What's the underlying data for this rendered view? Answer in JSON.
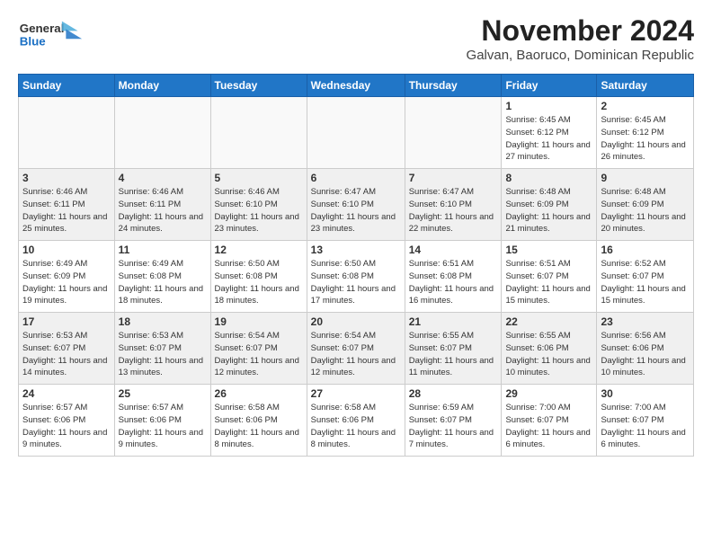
{
  "header": {
    "logo_line1": "General",
    "logo_line2": "Blue",
    "title": "November 2024",
    "subtitle": "Galvan, Baoruco, Dominican Republic"
  },
  "days_of_week": [
    "Sunday",
    "Monday",
    "Tuesday",
    "Wednesday",
    "Thursday",
    "Friday",
    "Saturday"
  ],
  "weeks": [
    [
      {
        "day": "",
        "info": "",
        "empty": true
      },
      {
        "day": "",
        "info": "",
        "empty": true
      },
      {
        "day": "",
        "info": "",
        "empty": true
      },
      {
        "day": "",
        "info": "",
        "empty": true
      },
      {
        "day": "",
        "info": "",
        "empty": true
      },
      {
        "day": "1",
        "info": "Sunrise: 6:45 AM\nSunset: 6:12 PM\nDaylight: 11 hours\nand 27 minutes."
      },
      {
        "day": "2",
        "info": "Sunrise: 6:45 AM\nSunset: 6:12 PM\nDaylight: 11 hours\nand 26 minutes."
      }
    ],
    [
      {
        "day": "3",
        "info": "Sunrise: 6:46 AM\nSunset: 6:11 PM\nDaylight: 11 hours\nand 25 minutes."
      },
      {
        "day": "4",
        "info": "Sunrise: 6:46 AM\nSunset: 6:11 PM\nDaylight: 11 hours\nand 24 minutes."
      },
      {
        "day": "5",
        "info": "Sunrise: 6:46 AM\nSunset: 6:10 PM\nDaylight: 11 hours\nand 23 minutes."
      },
      {
        "day": "6",
        "info": "Sunrise: 6:47 AM\nSunset: 6:10 PM\nDaylight: 11 hours\nand 23 minutes."
      },
      {
        "day": "7",
        "info": "Sunrise: 6:47 AM\nSunset: 6:10 PM\nDaylight: 11 hours\nand 22 minutes."
      },
      {
        "day": "8",
        "info": "Sunrise: 6:48 AM\nSunset: 6:09 PM\nDaylight: 11 hours\nand 21 minutes."
      },
      {
        "day": "9",
        "info": "Sunrise: 6:48 AM\nSunset: 6:09 PM\nDaylight: 11 hours\nand 20 minutes."
      }
    ],
    [
      {
        "day": "10",
        "info": "Sunrise: 6:49 AM\nSunset: 6:09 PM\nDaylight: 11 hours\nand 19 minutes."
      },
      {
        "day": "11",
        "info": "Sunrise: 6:49 AM\nSunset: 6:08 PM\nDaylight: 11 hours\nand 18 minutes."
      },
      {
        "day": "12",
        "info": "Sunrise: 6:50 AM\nSunset: 6:08 PM\nDaylight: 11 hours\nand 18 minutes."
      },
      {
        "day": "13",
        "info": "Sunrise: 6:50 AM\nSunset: 6:08 PM\nDaylight: 11 hours\nand 17 minutes."
      },
      {
        "day": "14",
        "info": "Sunrise: 6:51 AM\nSunset: 6:08 PM\nDaylight: 11 hours\nand 16 minutes."
      },
      {
        "day": "15",
        "info": "Sunrise: 6:51 AM\nSunset: 6:07 PM\nDaylight: 11 hours\nand 15 minutes."
      },
      {
        "day": "16",
        "info": "Sunrise: 6:52 AM\nSunset: 6:07 PM\nDaylight: 11 hours\nand 15 minutes."
      }
    ],
    [
      {
        "day": "17",
        "info": "Sunrise: 6:53 AM\nSunset: 6:07 PM\nDaylight: 11 hours\nand 14 minutes."
      },
      {
        "day": "18",
        "info": "Sunrise: 6:53 AM\nSunset: 6:07 PM\nDaylight: 11 hours\nand 13 minutes."
      },
      {
        "day": "19",
        "info": "Sunrise: 6:54 AM\nSunset: 6:07 PM\nDaylight: 11 hours\nand 12 minutes."
      },
      {
        "day": "20",
        "info": "Sunrise: 6:54 AM\nSunset: 6:07 PM\nDaylight: 11 hours\nand 12 minutes."
      },
      {
        "day": "21",
        "info": "Sunrise: 6:55 AM\nSunset: 6:07 PM\nDaylight: 11 hours\nand 11 minutes."
      },
      {
        "day": "22",
        "info": "Sunrise: 6:55 AM\nSunset: 6:06 PM\nDaylight: 11 hours\nand 10 minutes."
      },
      {
        "day": "23",
        "info": "Sunrise: 6:56 AM\nSunset: 6:06 PM\nDaylight: 11 hours\nand 10 minutes."
      }
    ],
    [
      {
        "day": "24",
        "info": "Sunrise: 6:57 AM\nSunset: 6:06 PM\nDaylight: 11 hours\nand 9 minutes."
      },
      {
        "day": "25",
        "info": "Sunrise: 6:57 AM\nSunset: 6:06 PM\nDaylight: 11 hours\nand 9 minutes."
      },
      {
        "day": "26",
        "info": "Sunrise: 6:58 AM\nSunset: 6:06 PM\nDaylight: 11 hours\nand 8 minutes."
      },
      {
        "day": "27",
        "info": "Sunrise: 6:58 AM\nSunset: 6:06 PM\nDaylight: 11 hours\nand 8 minutes."
      },
      {
        "day": "28",
        "info": "Sunrise: 6:59 AM\nSunset: 6:07 PM\nDaylight: 11 hours\nand 7 minutes."
      },
      {
        "day": "29",
        "info": "Sunrise: 7:00 AM\nSunset: 6:07 PM\nDaylight: 11 hours\nand 6 minutes."
      },
      {
        "day": "30",
        "info": "Sunrise: 7:00 AM\nSunset: 6:07 PM\nDaylight: 11 hours\nand 6 minutes."
      }
    ]
  ]
}
